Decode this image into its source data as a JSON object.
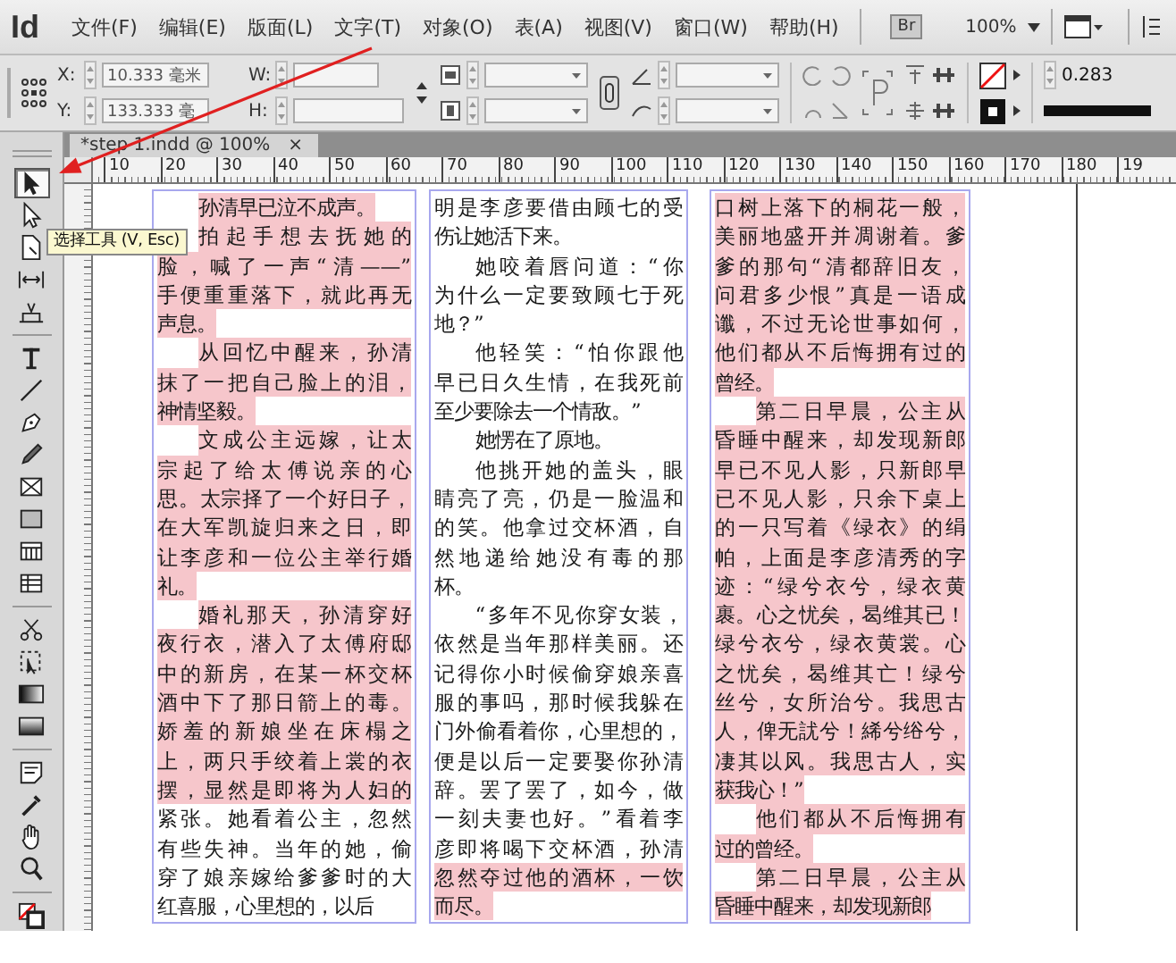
{
  "app": {
    "logo": "Id",
    "menu": [
      "文件(F)",
      "编辑(E)",
      "版面(L)",
      "文字(T)",
      "对象(O)",
      "表(A)",
      "视图(V)",
      "窗口(W)",
      "帮助(H)"
    ],
    "bridge": "Br",
    "zoom": "100%"
  },
  "control_panel": {
    "x": {
      "label": "X:",
      "value": "10.333 毫米"
    },
    "y": {
      "label": "Y:",
      "value": "133.333 毫"
    },
    "w": {
      "label": "W:"
    },
    "h": {
      "label": "H:"
    },
    "stroke_weight": "0.283"
  },
  "document_tab": {
    "title": "*step 1.indd @ 100%",
    "close": "×"
  },
  "ruler": [
    "10",
    "20",
    "30",
    "40",
    "50",
    "60",
    "70",
    "80",
    "90",
    "100",
    "110",
    "120",
    "130",
    "140",
    "150",
    "160",
    "170",
    "180",
    "19"
  ],
  "tools": [
    {
      "kind": "selection",
      "selected": true
    },
    {
      "kind": "direct",
      "selected": false
    },
    {
      "kind": "page",
      "selected": false
    },
    {
      "kind": "gap",
      "selected": false
    },
    {
      "kind": "collector",
      "selected": false
    },
    {
      "kind": "divider"
    },
    {
      "kind": "type",
      "selected": false
    },
    {
      "kind": "line",
      "selected": false
    },
    {
      "kind": "pen",
      "selected": false
    },
    {
      "kind": "pencil",
      "selected": false
    },
    {
      "kind": "frame",
      "selected": false
    },
    {
      "kind": "rect",
      "selected": false
    },
    {
      "kind": "tableh",
      "selected": false
    },
    {
      "kind": "tablev",
      "selected": false
    },
    {
      "kind": "divider"
    },
    {
      "kind": "scissors",
      "selected": false
    },
    {
      "kind": "transform",
      "selected": false
    },
    {
      "kind": "gradient",
      "selected": false
    },
    {
      "kind": "feather",
      "selected": false
    },
    {
      "kind": "divider"
    },
    {
      "kind": "note",
      "selected": false
    },
    {
      "kind": "eyedropper",
      "selected": false
    },
    {
      "kind": "hand",
      "selected": false
    },
    {
      "kind": "zoom",
      "selected": false
    },
    {
      "kind": "divider"
    },
    {
      "kind": "fillstroke",
      "selected": false
    }
  ],
  "tooltip": "选择工具 (V, Esc)",
  "columns": [
    {
      "paragraphs": [
        {
          "continued": false,
          "lines": [
            {
              "text": "孙清早已泣不成声。",
              "highlighted": true
            }
          ]
        },
        {
          "continued": false,
          "lines": [
            {
              "text": "拍起手想去抚她的",
              "highlighted": true
            },
            {
              "text": "脸，喊了一声“清——”",
              "highlighted": true
            },
            {
              "text": "手便重重落下，就此再无",
              "highlighted": true
            },
            {
              "text": "声息。",
              "highlighted": true
            }
          ]
        },
        {
          "continued": false,
          "lines": [
            {
              "text": "从回忆中醒来，孙清",
              "highlighted": true
            },
            {
              "text": "抹了一把自己脸上的泪，",
              "highlighted": true
            },
            {
              "text": "神情坚毅。",
              "highlighted": true
            }
          ]
        },
        {
          "continued": false,
          "lines": [
            {
              "text": "文成公主远嫁，让太",
              "highlighted": true
            },
            {
              "text": "宗起了给太傅说亲的心",
              "highlighted": true
            },
            {
              "text": "思。太宗择了一个好日子，",
              "highlighted": true
            },
            {
              "text": "在大军凯旋归来之日，即",
              "highlighted": true
            },
            {
              "text": "让李彦和一位公主举行婚",
              "highlighted": true
            },
            {
              "text": "礼。",
              "highlighted": true
            }
          ]
        },
        {
          "continued": false,
          "lines": [
            {
              "text": "婚礼那天，孙清穿好",
              "highlighted": true
            },
            {
              "text": "夜行衣，潜入了太傅府邸",
              "highlighted": true
            },
            {
              "text": "中的新房，在某一杯交杯",
              "highlighted": true
            },
            {
              "text": "酒中下了那日箭上的毒。",
              "highlighted": true
            },
            {
              "text": "娇羞的新娘坐在床榻之",
              "highlighted": true
            },
            {
              "text": "上，两只手绞着上裳的衣",
              "highlighted": true
            },
            {
              "text": "摆，显然是即将为人妇的",
              "highlighted": true
            },
            {
              "text": "紧张。她看着公主，忽然",
              "highlighted": false
            },
            {
              "text": "有些失神。当年的她，偷",
              "highlighted": false
            },
            {
              "text": "穿了娘亲嫁给爹爹时的大",
              "highlighted": false
            },
            {
              "text": "红喜服，心里想的，以后",
              "highlighted": false
            }
          ]
        }
      ]
    },
    {
      "paragraphs": [
        {
          "continued": true,
          "lines": [
            {
              "text": "明是李彦要借由顾七的受",
              "highlighted": false
            },
            {
              "text": "伤让她活下来。",
              "highlighted": false
            }
          ]
        },
        {
          "continued": false,
          "lines": [
            {
              "text": "她咬着唇问道：“你",
              "highlighted": false
            },
            {
              "text": "为什么一定要致顾七于死",
              "highlighted": false
            },
            {
              "text": "地？”",
              "highlighted": false
            }
          ]
        },
        {
          "continued": false,
          "lines": [
            {
              "text": "他轻笑：“怕你跟他",
              "highlighted": false
            },
            {
              "text": "早已日久生情，在我死前",
              "highlighted": false
            },
            {
              "text": "至少要除去一个情敌。”",
              "highlighted": false
            }
          ]
        },
        {
          "continued": false,
          "lines": [
            {
              "text": "她愣在了原地。",
              "highlighted": false
            }
          ]
        },
        {
          "continued": false,
          "lines": [
            {
              "text": "他挑开她的盖头，眼",
              "highlighted": false
            },
            {
              "text": "睛亮了亮，仍是一脸温和",
              "highlighted": false
            },
            {
              "text": "的笑。他拿过交杯酒，自",
              "highlighted": false
            },
            {
              "text": "然地递给她没有毒的那",
              "highlighted": false
            },
            {
              "text": "杯。",
              "highlighted": false
            }
          ]
        },
        {
          "continued": false,
          "lines": [
            {
              "text": "“多年不见你穿女装，",
              "highlighted": false
            },
            {
              "text": "依然是当年那样美丽。还",
              "highlighted": false
            },
            {
              "text": "记得你小时候偷穿娘亲喜",
              "highlighted": false
            },
            {
              "text": "服的事吗，那时候我躲在",
              "highlighted": false
            },
            {
              "text": "门外偷看着你，心里想的，",
              "highlighted": false
            },
            {
              "text": "便是以后一定要娶你孙清",
              "highlighted": false
            },
            {
              "text": "辞。罢了罢了，如今，做",
              "highlighted": false
            },
            {
              "text": "一刻夫妻也好。”看着李",
              "highlighted": false
            },
            {
              "text": "彦即将喝下交杯酒，孙清",
              "highlighted": false
            },
            {
              "text": "忽然夺过他的酒杯，一饮",
              "highlighted": true
            },
            {
              "text": "而尽。",
              "highlighted": true
            }
          ]
        }
      ]
    },
    {
      "paragraphs": [
        {
          "continued": true,
          "lines": [
            {
              "text": "口树上落下的桐花一般，",
              "highlighted": true
            },
            {
              "text": "美丽地盛开并凋谢着。爹",
              "highlighted": true
            },
            {
              "text": "爹的那句“清都辞旧友，",
              "highlighted": true
            },
            {
              "text": "问君多少恨”真是一语成",
              "highlighted": true
            },
            {
              "text": "谶，不过无论世事如何，",
              "highlighted": true
            },
            {
              "text": "他们都从不后悔拥有过的",
              "highlighted": true
            },
            {
              "text": "曾经。",
              "highlighted": true
            }
          ]
        },
        {
          "continued": false,
          "lines": [
            {
              "text": "第二日早晨，公主从",
              "highlighted": true
            },
            {
              "text": "昏睡中醒来，却发现新郎",
              "highlighted": true
            },
            {
              "text": "早已不见人影，只新郎早",
              "highlighted": true
            },
            {
              "text": "已不见人影，只余下桌上",
              "highlighted": true
            },
            {
              "text": "的一只写着《绿衣》的绢",
              "highlighted": true
            },
            {
              "text": "帕，上面是李彦清秀的字",
              "highlighted": true
            },
            {
              "text": "迹：“绿兮衣兮，绿衣黄",
              "highlighted": true
            },
            {
              "text": "裹。心之忧矣，曷维其已！",
              "highlighted": true
            },
            {
              "text": "绿兮衣兮，绿衣黄裳。心",
              "highlighted": true
            },
            {
              "text": "之忧矣，曷维其亡！绿兮",
              "highlighted": true
            },
            {
              "text": "丝兮，女所治兮。我思古",
              "highlighted": true
            },
            {
              "text": "人，俾无訧兮！絺兮绤兮，",
              "highlighted": true
            },
            {
              "text": "凄其以风。我思古人，实",
              "highlighted": true
            },
            {
              "text": "获我心！”",
              "highlighted": true
            }
          ]
        },
        {
          "continued": false,
          "lines": [
            {
              "text": "他们都从不后悔拥有",
              "highlighted": true
            },
            {
              "text": "过的曾经。",
              "highlighted": true
            }
          ]
        },
        {
          "continued": false,
          "lines": [
            {
              "text": "第二日早晨，公主从",
              "highlighted": true
            },
            {
              "text": "昏睡中醒来，却发现新郎",
              "highlighted": true
            }
          ]
        }
      ]
    }
  ]
}
